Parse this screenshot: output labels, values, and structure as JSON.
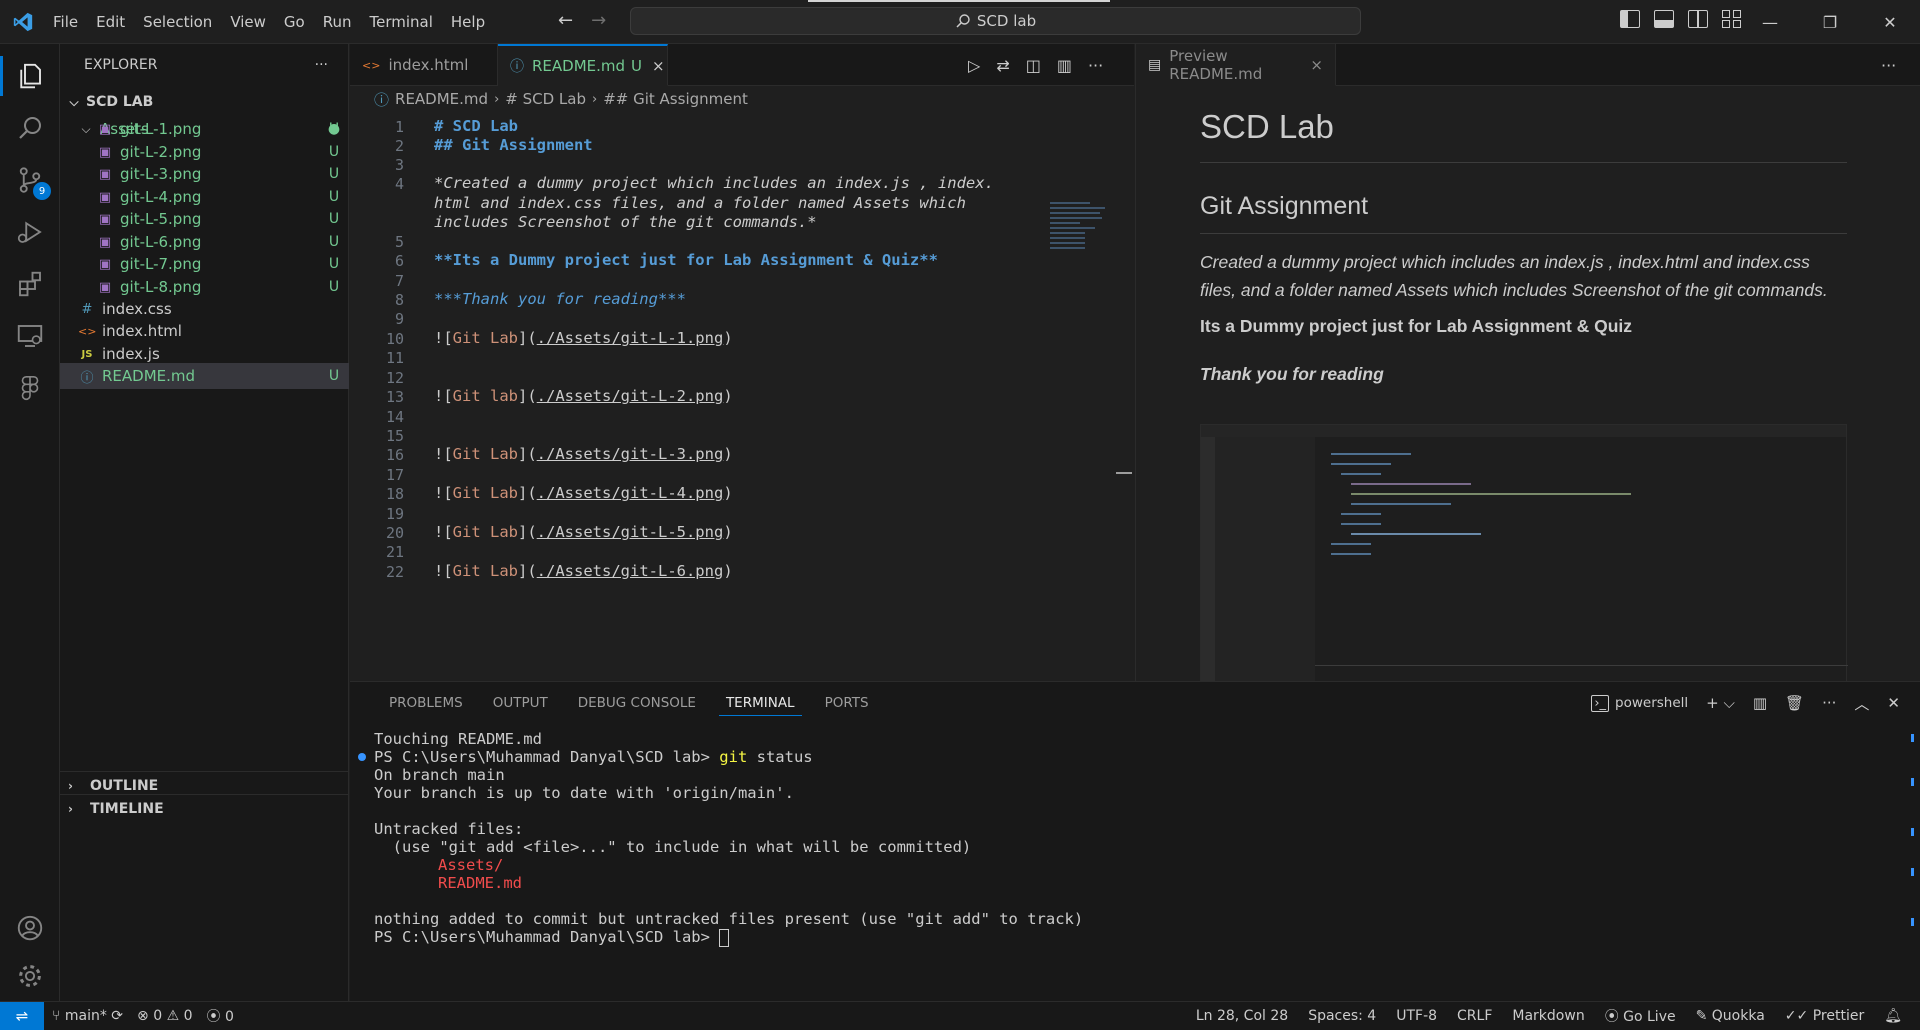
{
  "menu": [
    "File",
    "Edit",
    "Selection",
    "View",
    "Go",
    "Run",
    "Terminal",
    "Help"
  ],
  "command_center": {
    "label": "SCD lab",
    "icon": "search-icon"
  },
  "colors": {
    "accent": "#0078d4",
    "git_untracked": "#73c991",
    "heading": "#569cd6",
    "link_text": "#ce9178",
    "term_yellow": "#f5f543",
    "term_red": "#f14c4c"
  },
  "activity_bar": {
    "source_control_badge": "9"
  },
  "explorer": {
    "title": "EXPLORER",
    "more": "···",
    "root": "SCD LAB",
    "folder": {
      "name": "Assets",
      "files": [
        "git-L-1.png",
        "git-L-2.png",
        "git-L-3.png",
        "git-L-4.png",
        "git-L-5.png",
        "git-L-6.png",
        "git-L-7.png",
        "git-L-8.png"
      ],
      "status": "U"
    },
    "files": [
      {
        "icon": "#",
        "name": "index.css",
        "status": ""
      },
      {
        "icon": "<>",
        "name": "index.html",
        "status": ""
      },
      {
        "icon": "JS",
        "name": "index.js",
        "status": ""
      },
      {
        "icon": "ⓘ",
        "name": "README.md",
        "status": "U"
      }
    ],
    "outline": "OUTLINE",
    "timeline": "TIMELINE"
  },
  "editor": {
    "tabs": [
      {
        "label": "index.html",
        "icon": "<>"
      },
      {
        "label": "README.md",
        "icon": "ⓘ",
        "status": "U",
        "close": "×"
      }
    ],
    "breadcrumbs": [
      "README.md",
      "# SCD Lab",
      "## Git Assignment"
    ],
    "lines": [
      {
        "n": "1",
        "text": "# SCD Lab"
      },
      {
        "n": "2",
        "text": "## Git Assignment"
      },
      {
        "n": "3",
        "text": ""
      },
      {
        "n": "4",
        "text": "*Created a dummy project which includes an index.js , index.",
        "wrap": [
          "html and index.css files, and a folder named Assets which",
          "includes Screenshot of the git commands.*"
        ]
      },
      {
        "n": "5",
        "text": ""
      },
      {
        "n": "6",
        "text": "**Its a Dummy project just for Lab Assignment & Quiz**"
      },
      {
        "n": "7",
        "text": ""
      },
      {
        "n": "8",
        "text": "***Thank you for reading***"
      },
      {
        "n": "9",
        "text": ""
      },
      {
        "n": "10",
        "alt": "Git Lab",
        "url": "./Assets/git-L-1.png"
      },
      {
        "n": "11",
        "text": ""
      },
      {
        "n": "12",
        "text": ""
      },
      {
        "n": "13",
        "alt": "Git lab",
        "url": "./Assets/git-L-2.png"
      },
      {
        "n": "14",
        "text": ""
      },
      {
        "n": "15",
        "text": ""
      },
      {
        "n": "16",
        "alt": "Git Lab",
        "url": "./Assets/git-L-3.png"
      },
      {
        "n": "17",
        "text": ""
      },
      {
        "n": "18",
        "alt": "Git Lab",
        "url": "./Assets/git-L-4.png"
      },
      {
        "n": "19",
        "text": ""
      },
      {
        "n": "20",
        "alt": "Git Lab",
        "url": "./Assets/git-L-5.png"
      },
      {
        "n": "21",
        "text": ""
      },
      {
        "n": "22",
        "alt": "Git Lab",
        "url": "./Assets/git-L-6.png"
      }
    ]
  },
  "preview": {
    "tab_label": "Preview README.md",
    "tab_close": "×",
    "h1": "SCD Lab",
    "h2": "Git Assignment",
    "paragraph": "Created a dummy project which includes an index.js , index.html and index.css files, and a folder named Assets which includes Screenshot of the git commands.",
    "bold": "Its a Dummy project just for Lab Assignment & Quiz",
    "bold_italic": "Thank you for reading"
  },
  "panel": {
    "tabs": [
      "PROBLEMS",
      "OUTPUT",
      "DEBUG CONSOLE",
      "TERMINAL",
      "PORTS"
    ],
    "active_tab": "TERMINAL",
    "shell": "powershell",
    "terminal": {
      "line1": "Touching README.md",
      "prompt": "PS C:\\Users\\Muhammad Danyal\\SCD lab>",
      "cmd_git": "git",
      "cmd_rest": " status",
      "line3": "On branch main",
      "line4": "Your branch is up to date with 'origin/main'.",
      "line5": "Untracked files:",
      "line6": "  (use \"git add <file>...\" to include in what will be committed)",
      "untracked": [
        "Assets/",
        "README.md"
      ],
      "line9": "nothing added to commit but untracked files present (use \"git add\" to track)"
    }
  },
  "statusbar": {
    "branch": "main*",
    "errors": "0",
    "warnings": "0",
    "ports": "0",
    "right": [
      "Ln 28, Col 28",
      "Spaces: 4",
      "UTF-8",
      "CRLF",
      "Markdown",
      "Go Live",
      "Quokka",
      "Prettier"
    ]
  }
}
